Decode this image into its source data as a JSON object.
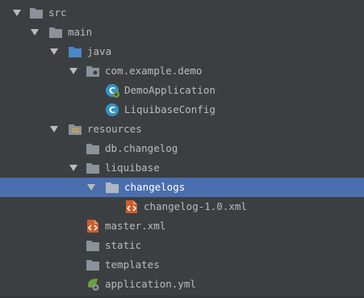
{
  "project_tree": {
    "items": [
      {
        "label": "src",
        "icon": "folder-icon",
        "expanded": true
      },
      {
        "label": "main",
        "icon": "folder-icon",
        "expanded": true
      },
      {
        "label": "java",
        "icon": "source-root-folder-icon",
        "expanded": true
      },
      {
        "label": "com.example.demo",
        "icon": "package-icon",
        "expanded": true
      },
      {
        "label": "DemoApplication",
        "icon": "spring-boot-class-icon"
      },
      {
        "label": "LiquibaseConfig",
        "icon": "java-class-icon"
      },
      {
        "label": "resources",
        "icon": "resources-root-folder-icon",
        "expanded": true
      },
      {
        "label": "db.changelog",
        "icon": "folder-icon",
        "expanded": false
      },
      {
        "label": "liquibase",
        "icon": "folder-icon",
        "expanded": true
      },
      {
        "label": "changelogs",
        "icon": "folder-icon",
        "expanded": true,
        "selected": true
      },
      {
        "label": "changelog-1.0.xml",
        "icon": "xml-file-icon"
      },
      {
        "label": "master.xml",
        "icon": "xml-file-icon"
      },
      {
        "label": "static",
        "icon": "folder-icon",
        "expanded": false
      },
      {
        "label": "templates",
        "icon": "folder-icon",
        "expanded": false
      },
      {
        "label": "application.yml",
        "icon": "spring-config-file-icon"
      }
    ]
  },
  "colors": {
    "background": "#3c3f41",
    "selection": "#4b6eaf",
    "text": "#bbbbbb",
    "folder": "#8b9299",
    "source_root": "#4a88c7",
    "class_icon": "#3592c4",
    "xml_icon": "#cc5f2c",
    "spring": "#6a9f3f"
  }
}
